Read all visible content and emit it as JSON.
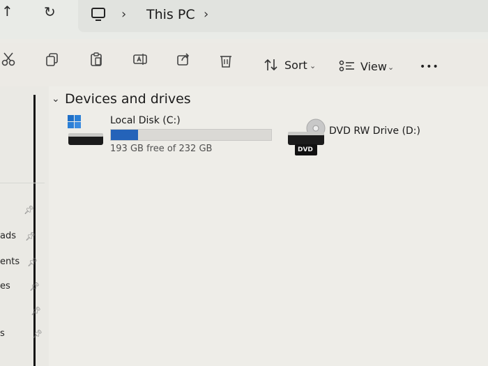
{
  "address": {
    "path_label": "This PC"
  },
  "toolbar": {
    "sort_label": "Sort",
    "view_label": "View",
    "more_label": "•••"
  },
  "sidebar": {
    "items": [
      {
        "label": "ads"
      },
      {
        "label": "ents"
      },
      {
        "label": "es"
      },
      {
        "label": ""
      },
      {
        "label": "s"
      }
    ]
  },
  "section": {
    "title": "Devices and drives"
  },
  "drives": [
    {
      "name": "Local Disk (C:)",
      "free_text": "193 GB free of 232 GB",
      "used_fraction": 0.168
    },
    {
      "name": "DVD RW Drive (D:)",
      "badge": "DVD"
    }
  ],
  "colors": {
    "usage_bar": "#2463b9"
  }
}
